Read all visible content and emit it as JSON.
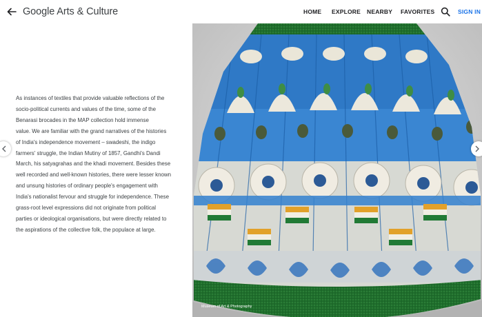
{
  "header": {
    "logo_brand": "Google",
    "logo_rest": " Arts & Culture",
    "nav": [
      "HOME",
      "EXPLORE",
      "NEARBY",
      "FAVORITES"
    ],
    "signin": "SIGN IN",
    "accent_color": "#1a73e8"
  },
  "icons": {
    "back": "back-arrow-icon",
    "search": "search-icon",
    "prev": "chevron-left-icon",
    "next": "chevron-right-icon"
  },
  "article": {
    "lines": [
      "As instances of textiles that provide valuable reflections of the",
      "socio-political currents and values of the time, some of the",
      "Benarasi brocades in the MAP collection hold immense",
      "value. We are familiar with the grand narratives of the histories",
      "of India's independence movement – swadeshi, the indigo",
      "farmers' struggle, the Indian Mutiny of 1857, Gandhi's Dandi",
      "March, his satyagrahas and the khadi movement. Besides these",
      "well recorded and well-known histories, there were lesser known",
      "and unsung histories of ordinary people's engagement with",
      "India's nationalist fervour and struggle for independence. These",
      "grass-root level expressions did not originate from political",
      "parties or ideological organisations, but were directly related to",
      "the aspirations of the collective folk, the populace at large."
    ]
  },
  "image": {
    "credit": "Museum of Art & Photography",
    "colors": {
      "green_band": "#1f6e2c",
      "blue": "#2d78c8",
      "cream": "#ece8dc",
      "saffron": "#e2a12a",
      "flag_green": "#217a35"
    }
  }
}
